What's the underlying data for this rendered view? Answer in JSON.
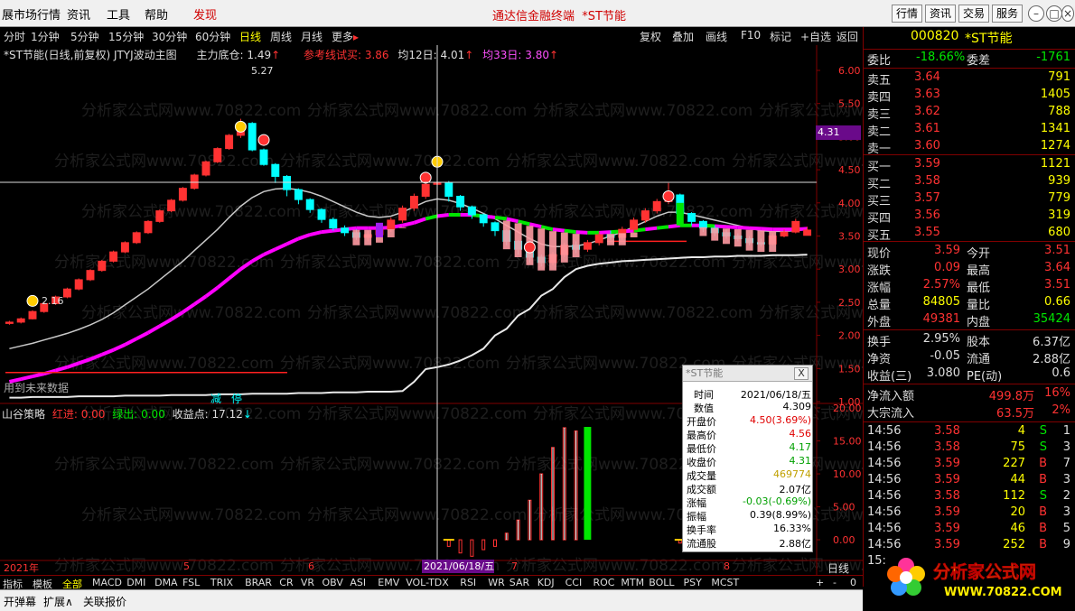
{
  "menubar": {
    "items": [
      "展市场行情",
      "资讯",
      "工具",
      "帮助",
      "发现"
    ],
    "active_index": 4,
    "center_title": "通达信金融终端",
    "center_stock": "*ST节能",
    "right_buttons": [
      "行情",
      "资讯",
      "交易",
      "服务"
    ]
  },
  "period_bar": {
    "periods": [
      "分时",
      "1分钟",
      "5分钟",
      "15分钟",
      "30分钟",
      "60分钟",
      "日线",
      "周线",
      "月线",
      "更多"
    ],
    "active_index": 6,
    "tools": [
      "复权",
      "叠加",
      "画线",
      "F10",
      "标记",
      "+自选",
      "返回"
    ]
  },
  "main_legend": {
    "title": "*ST节能(日线,前复权) JTYJ波动主图",
    "zhuli": "主力底仓: 1.49",
    "cankao": "参考线试买: 3.86",
    "ma12": "均12日: 4.01",
    "ma33": "均33日: 3.80"
  },
  "chart_labels": {
    "high_label": "5.27",
    "low_label": "2.16",
    "bottom_left": "用到未来数据",
    "jian": "减",
    "ting": "停",
    "crosshair_price": "4.31",
    "crosshair_date": "2021/06/18/五",
    "period_label": "日线",
    "x_axis_labels": [
      "2021年",
      "5",
      "6",
      "7",
      "8"
    ]
  },
  "sub_legend": {
    "name": "山谷策略",
    "hongjin": "红进: 0.00",
    "lvchu": "绿出: 0.00",
    "shouyi": "收益点: 17.12"
  },
  "chart_data": {
    "type": "candlestick",
    "price_axis": [
      "6.00",
      "5.50",
      "5.00",
      "4.50",
      "4.00",
      "3.50",
      "3.00",
      "2.50",
      "2.00",
      "1.50",
      "1.00"
    ],
    "ylim": [
      1.0,
      6.0
    ],
    "sub_axis": [
      "20.00",
      "15.00",
      "10.00",
      "5.00",
      "0.00"
    ],
    "sub_ylim": [
      -3.0,
      20.0
    ],
    "candles": [
      [
        2.18,
        2.2,
        2.22,
        2.16
      ],
      [
        2.2,
        2.25,
        2.27,
        2.18
      ],
      [
        2.25,
        2.36,
        2.38,
        2.24
      ],
      [
        2.36,
        2.48,
        2.5,
        2.34
      ],
      [
        2.48,
        2.58,
        2.6,
        2.46
      ],
      [
        2.58,
        2.7,
        2.72,
        2.56
      ],
      [
        2.7,
        2.84,
        2.86,
        2.68
      ],
      [
        2.84,
        2.98,
        3.0,
        2.82
      ],
      [
        2.98,
        3.12,
        3.14,
        2.96
      ],
      [
        3.12,
        3.26,
        3.28,
        3.1
      ],
      [
        3.26,
        3.4,
        3.42,
        3.24
      ],
      [
        3.4,
        3.55,
        3.57,
        3.38
      ],
      [
        3.55,
        3.72,
        3.74,
        3.53
      ],
      [
        3.72,
        3.88,
        3.9,
        3.7
      ],
      [
        3.88,
        4.04,
        4.06,
        3.86
      ],
      [
        4.04,
        4.22,
        4.24,
        4.02
      ],
      [
        4.22,
        4.42,
        4.44,
        4.2
      ],
      [
        4.42,
        4.62,
        4.64,
        4.4
      ],
      [
        4.62,
        4.82,
        4.84,
        4.6
      ],
      [
        4.82,
        5.02,
        5.04,
        4.8
      ],
      [
        5.02,
        5.2,
        5.27,
        4.98
      ],
      [
        5.2,
        4.8,
        5.22,
        4.78
      ],
      [
        4.8,
        4.58,
        4.82,
        4.56
      ],
      [
        4.58,
        4.4,
        4.6,
        4.3
      ],
      [
        4.4,
        4.2,
        4.42,
        4.1
      ],
      [
        4.2,
        4.05,
        4.22,
        3.98
      ],
      [
        4.05,
        3.9,
        4.07,
        3.85
      ],
      [
        3.9,
        3.75,
        3.92,
        3.7
      ],
      [
        3.75,
        3.62,
        3.78,
        3.58
      ],
      [
        3.62,
        3.55,
        3.66,
        3.5
      ],
      [
        3.55,
        3.48,
        3.6,
        3.44
      ],
      [
        3.48,
        3.52,
        3.58,
        3.42
      ],
      [
        3.52,
        3.6,
        3.64,
        3.48
      ],
      [
        3.6,
        3.74,
        3.78,
        3.56
      ],
      [
        3.74,
        3.92,
        3.96,
        3.7
      ],
      [
        3.92,
        4.1,
        4.14,
        3.88
      ],
      [
        4.1,
        4.28,
        4.34,
        4.06
      ],
      [
        4.28,
        4.31,
        4.56,
        4.17
      ],
      [
        4.31,
        4.1,
        4.33,
        4.02
      ],
      [
        4.1,
        3.94,
        4.12,
        3.88
      ],
      [
        3.94,
        3.82,
        3.96,
        3.76
      ],
      [
        3.82,
        3.7,
        3.84,
        3.64
      ],
      [
        3.7,
        3.58,
        3.72,
        3.5
      ],
      [
        3.58,
        3.42,
        3.6,
        3.36
      ],
      [
        3.42,
        3.3,
        3.44,
        3.22
      ],
      [
        3.3,
        3.18,
        3.32,
        3.1
      ],
      [
        3.18,
        3.1,
        3.22,
        3.04
      ],
      [
        3.1,
        3.22,
        3.26,
        3.06
      ],
      [
        3.22,
        3.36,
        3.4,
        3.18
      ],
      [
        3.36,
        3.3,
        3.42,
        3.24
      ],
      [
        3.3,
        3.4,
        3.44,
        3.26
      ],
      [
        3.4,
        3.52,
        3.56,
        3.36
      ],
      [
        3.52,
        3.48,
        3.58,
        3.44
      ],
      [
        3.48,
        3.6,
        3.64,
        3.44
      ],
      [
        3.6,
        3.74,
        3.78,
        3.56
      ],
      [
        3.74,
        3.88,
        3.92,
        3.7
      ],
      [
        3.88,
        4.02,
        4.06,
        3.84
      ],
      [
        4.02,
        4.12,
        4.3,
        3.98
      ],
      [
        4.12,
        3.84,
        4.14,
        3.78
      ],
      [
        3.84,
        3.72,
        3.86,
        3.66
      ],
      [
        3.72,
        3.62,
        3.74,
        3.56
      ],
      [
        3.62,
        3.55,
        3.66,
        3.5
      ],
      [
        3.55,
        3.5,
        3.6,
        3.46
      ],
      [
        3.5,
        3.46,
        3.54,
        3.42
      ],
      [
        3.46,
        3.4,
        3.5,
        3.36
      ],
      [
        3.4,
        3.38,
        3.46,
        3.34
      ],
      [
        3.38,
        3.5,
        3.54,
        3.36
      ],
      [
        3.5,
        3.56,
        3.6,
        3.48
      ],
      [
        3.56,
        3.72,
        3.76,
        3.54
      ],
      [
        3.51,
        3.59,
        3.64,
        3.51
      ]
    ],
    "ma_white": [
      1.8,
      1.84,
      1.88,
      1.93,
      1.98,
      2.03,
      2.09,
      2.16,
      2.24,
      2.34,
      2.46,
      2.58,
      2.7,
      2.84,
      2.98,
      3.12,
      3.28,
      3.44,
      3.6,
      3.78,
      3.95,
      4.08,
      4.17,
      4.21,
      4.22,
      4.2,
      4.16,
      4.1,
      4.02,
      3.94,
      3.86,
      3.8,
      3.78,
      3.8,
      3.86,
      3.94,
      4.02,
      4.06,
      4.04,
      3.99,
      3.92,
      3.84,
      3.76,
      3.66,
      3.56,
      3.46,
      3.38,
      3.34,
      3.34,
      3.35,
      3.38,
      3.44,
      3.5,
      3.56,
      3.64,
      3.72,
      3.8,
      3.86,
      3.86,
      3.82,
      3.78,
      3.74,
      3.7,
      3.66,
      3.62,
      3.58,
      3.57,
      3.57,
      3.58,
      3.6
    ],
    "ma_magenta": [
      1.3,
      1.34,
      1.38,
      1.42,
      1.47,
      1.52,
      1.58,
      1.64,
      1.71,
      1.78,
      1.86,
      1.95,
      2.04,
      2.14,
      2.24,
      2.35,
      2.47,
      2.59,
      2.72,
      2.86,
      3.0,
      3.12,
      3.22,
      3.3,
      3.38,
      3.46,
      3.52,
      3.56,
      3.58,
      3.6,
      3.62,
      3.62,
      3.62,
      3.63,
      3.66,
      3.7,
      3.76,
      3.8,
      3.82,
      3.82,
      3.82,
      3.8,
      3.78,
      3.76,
      3.72,
      3.68,
      3.64,
      3.6,
      3.58,
      3.56,
      3.55,
      3.55,
      3.56,
      3.57,
      3.58,
      3.6,
      3.62,
      3.64,
      3.66,
      3.66,
      3.66,
      3.65,
      3.64,
      3.63,
      3.62,
      3.61,
      3.6,
      3.6,
      3.6,
      3.61
    ],
    "white_bottom": [
      1.06,
      1.06,
      1.07,
      1.07,
      1.07,
      1.07,
      1.08,
      1.08,
      1.08,
      1.08,
      1.09,
      1.09,
      1.09,
      1.09,
      1.1,
      1.1,
      1.1,
      1.1,
      1.11,
      1.11,
      1.11,
      1.12,
      1.12,
      1.12,
      1.12,
      1.13,
      1.13,
      1.13,
      1.14,
      1.14,
      1.14,
      1.15,
      1.15,
      1.15,
      1.16,
      1.3,
      1.49,
      1.52,
      1.56,
      1.62,
      1.7,
      1.8,
      2.0,
      2.1,
      2.3,
      2.4,
      2.6,
      2.7,
      2.88,
      3.0,
      3.05,
      3.08,
      3.1,
      3.12,
      3.13,
      3.14,
      3.15,
      3.16,
      3.17,
      3.18,
      3.18,
      3.19,
      3.19,
      3.2,
      3.2,
      3.2,
      3.21,
      3.21,
      3.21,
      3.22
    ],
    "sub_bars": [
      0,
      0,
      0,
      0,
      0,
      0,
      0,
      0,
      0,
      0,
      0,
      0,
      0,
      0,
      0,
      0,
      0,
      0,
      0,
      0,
      0,
      0,
      0,
      0,
      0,
      0,
      0,
      0,
      0,
      0,
      0,
      0,
      0,
      0,
      0,
      0,
      0,
      0,
      -1.0,
      -2.0,
      -2.5,
      -1.5,
      -1.0,
      1.0,
      3.0,
      6.0,
      10.0,
      14.0,
      17.0,
      16.5,
      17.12,
      0,
      0,
      0,
      0,
      0,
      0,
      0,
      -0.5,
      2.0,
      4.0,
      5.5,
      4.0,
      0,
      0,
      4.5,
      3.5,
      0,
      0,
      0
    ]
  },
  "right_panel": {
    "code": "000820",
    "name": "*ST节能",
    "weibi_label": "委比",
    "weibi_value": "-18.66%",
    "weicha_label": "委差",
    "weicha_value": "-1761",
    "asks": [
      {
        "label": "卖五",
        "price": "3.64",
        "vol": "791"
      },
      {
        "label": "卖四",
        "price": "3.63",
        "vol": "1405"
      },
      {
        "label": "卖三",
        "price": "3.62",
        "vol": "788"
      },
      {
        "label": "卖二",
        "price": "3.61",
        "vol": "1341"
      },
      {
        "label": "卖一",
        "price": "3.60",
        "vol": "1274"
      }
    ],
    "bids": [
      {
        "label": "买一",
        "price": "3.59",
        "vol": "1121"
      },
      {
        "label": "买二",
        "price": "3.58",
        "vol": "939"
      },
      {
        "label": "买三",
        "price": "3.57",
        "vol": "779"
      },
      {
        "label": "买四",
        "price": "3.56",
        "vol": "319"
      },
      {
        "label": "买五",
        "price": "3.55",
        "vol": "680"
      }
    ],
    "stats": [
      {
        "l1": "现价",
        "v1": "3.59",
        "l2": "今开",
        "v2": "3.51"
      },
      {
        "l1": "涨跌",
        "v1": "0.09",
        "l2": "最高",
        "v2": "3.64"
      },
      {
        "l1": "涨幅",
        "v1": "2.57%",
        "l2": "最低",
        "v2": "3.51"
      },
      {
        "l1": "总量",
        "v1": "84805",
        "l2": "量比",
        "v2": "0.66"
      },
      {
        "l1": "外盘",
        "v1": "49381",
        "l2": "内盘",
        "v2": "35424"
      }
    ],
    "stats2": [
      {
        "l1": "换手",
        "v1": "2.95%",
        "l2": "股本",
        "v2": "6.37亿"
      },
      {
        "l1": "净资",
        "v1": "-0.05",
        "l2": "流通",
        "v2": "2.88亿"
      },
      {
        "l1": "收益(三)",
        "v1": "3.080",
        "l2": "PE(动)",
        "v2": "0.6"
      }
    ],
    "flow": [
      {
        "label": "净流入额",
        "value": "499.8万",
        "pct": "16%"
      },
      {
        "label": "大宗流入",
        "value": "63.5万",
        "pct": "2%"
      }
    ],
    "ticks": [
      {
        "time": "14:56",
        "price": "3.58",
        "vol": "4",
        "side": "S",
        "n": "1"
      },
      {
        "time": "14:56",
        "price": "3.58",
        "vol": "75",
        "side": "S",
        "n": "3"
      },
      {
        "time": "14:56",
        "price": "3.59",
        "vol": "227",
        "side": "B",
        "n": "7"
      },
      {
        "time": "14:56",
        "price": "3.59",
        "vol": "44",
        "side": "B",
        "n": "3"
      },
      {
        "time": "14:56",
        "price": "3.58",
        "vol": "112",
        "side": "S",
        "n": "2"
      },
      {
        "time": "14:56",
        "price": "3.59",
        "vol": "20",
        "side": "B",
        "n": "3"
      },
      {
        "time": "14:56",
        "price": "3.59",
        "vol": "46",
        "side": "B",
        "n": "5"
      },
      {
        "time": "14:56",
        "price": "3.59",
        "vol": "252",
        "side": "B",
        "n": "9"
      },
      {
        "time": "15:",
        "price": "",
        "vol": "",
        "side": "",
        "n": ""
      }
    ]
  },
  "popup": {
    "title": "*ST节能",
    "close": "X",
    "rows": [
      {
        "label": "时间",
        "value": "2021/06/18/五",
        "color": "#000"
      },
      {
        "label": "数值",
        "value": "4.309",
        "color": "#000"
      },
      {
        "label": "开盘价",
        "value": "4.50(3.69%)",
        "color": "#e00000"
      },
      {
        "label": "最高价",
        "value": "4.56",
        "color": "#e00000"
      },
      {
        "label": "最低价",
        "value": "4.17",
        "color": "#00a000"
      },
      {
        "label": "收盘价",
        "value": "4.31",
        "color": "#00a000"
      },
      {
        "label": "成交量",
        "value": "469774",
        "color": "#c0a000"
      },
      {
        "label": "成交额",
        "value": "2.07亿",
        "color": "#000"
      },
      {
        "label": "涨幅",
        "value": "-0.03(-0.69%)",
        "color": "#00a000"
      },
      {
        "label": "振幅",
        "value": "0.39(8.99%)",
        "color": "#000"
      },
      {
        "label": "换手率",
        "value": "16.33%",
        "color": "#000"
      },
      {
        "label": "流通股",
        "value": "2.88亿",
        "color": "#000"
      }
    ]
  },
  "tabbar1": {
    "tabs": [
      "指标",
      "模板",
      "全部",
      "MACD",
      "DMI",
      "DMA",
      "FSL",
      "TRIX",
      "BRAR",
      "CR",
      "VR",
      "OBV",
      "ASI",
      "EMV",
      "VOL-TDX",
      "RSI",
      "WR",
      "SAR",
      "KDJ",
      "CCI",
      "ROC",
      "MTM",
      "BOLL",
      "PSY",
      "MCST"
    ],
    "active_index": 2,
    "right_controls": [
      "+",
      "-",
      "0"
    ]
  },
  "tabbar2": {
    "tabs": [
      "开弹幕",
      "扩展∧",
      "关联报价"
    ]
  },
  "watermark": "分析家公式网www.70822.com",
  "logo": {
    "line1": "分析家公式网",
    "line2": "WWW.70822.COM"
  },
  "colors": {
    "up": "#ff3232",
    "down": "#00ffff",
    "magenta": "#ff00ff",
    "green_line": "#00e600",
    "white_line": "#e0e0e0",
    "axis_border": "#800000"
  }
}
